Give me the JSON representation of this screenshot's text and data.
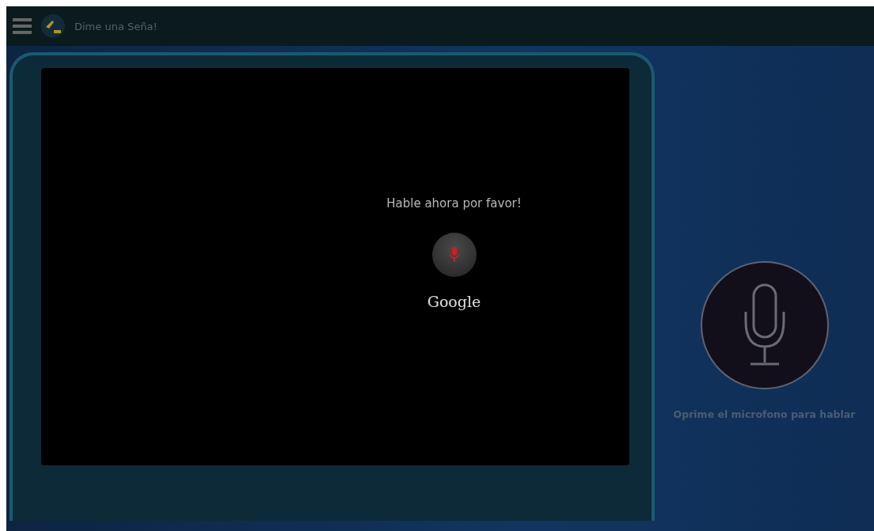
{
  "app_bar": {
    "title": "Dime una Seña!"
  },
  "speech_dialog": {
    "prompt": "Hable ahora por favor!",
    "brand": "Google"
  },
  "mic_panel": {
    "caption": "Oprime el microfono para hablar"
  }
}
